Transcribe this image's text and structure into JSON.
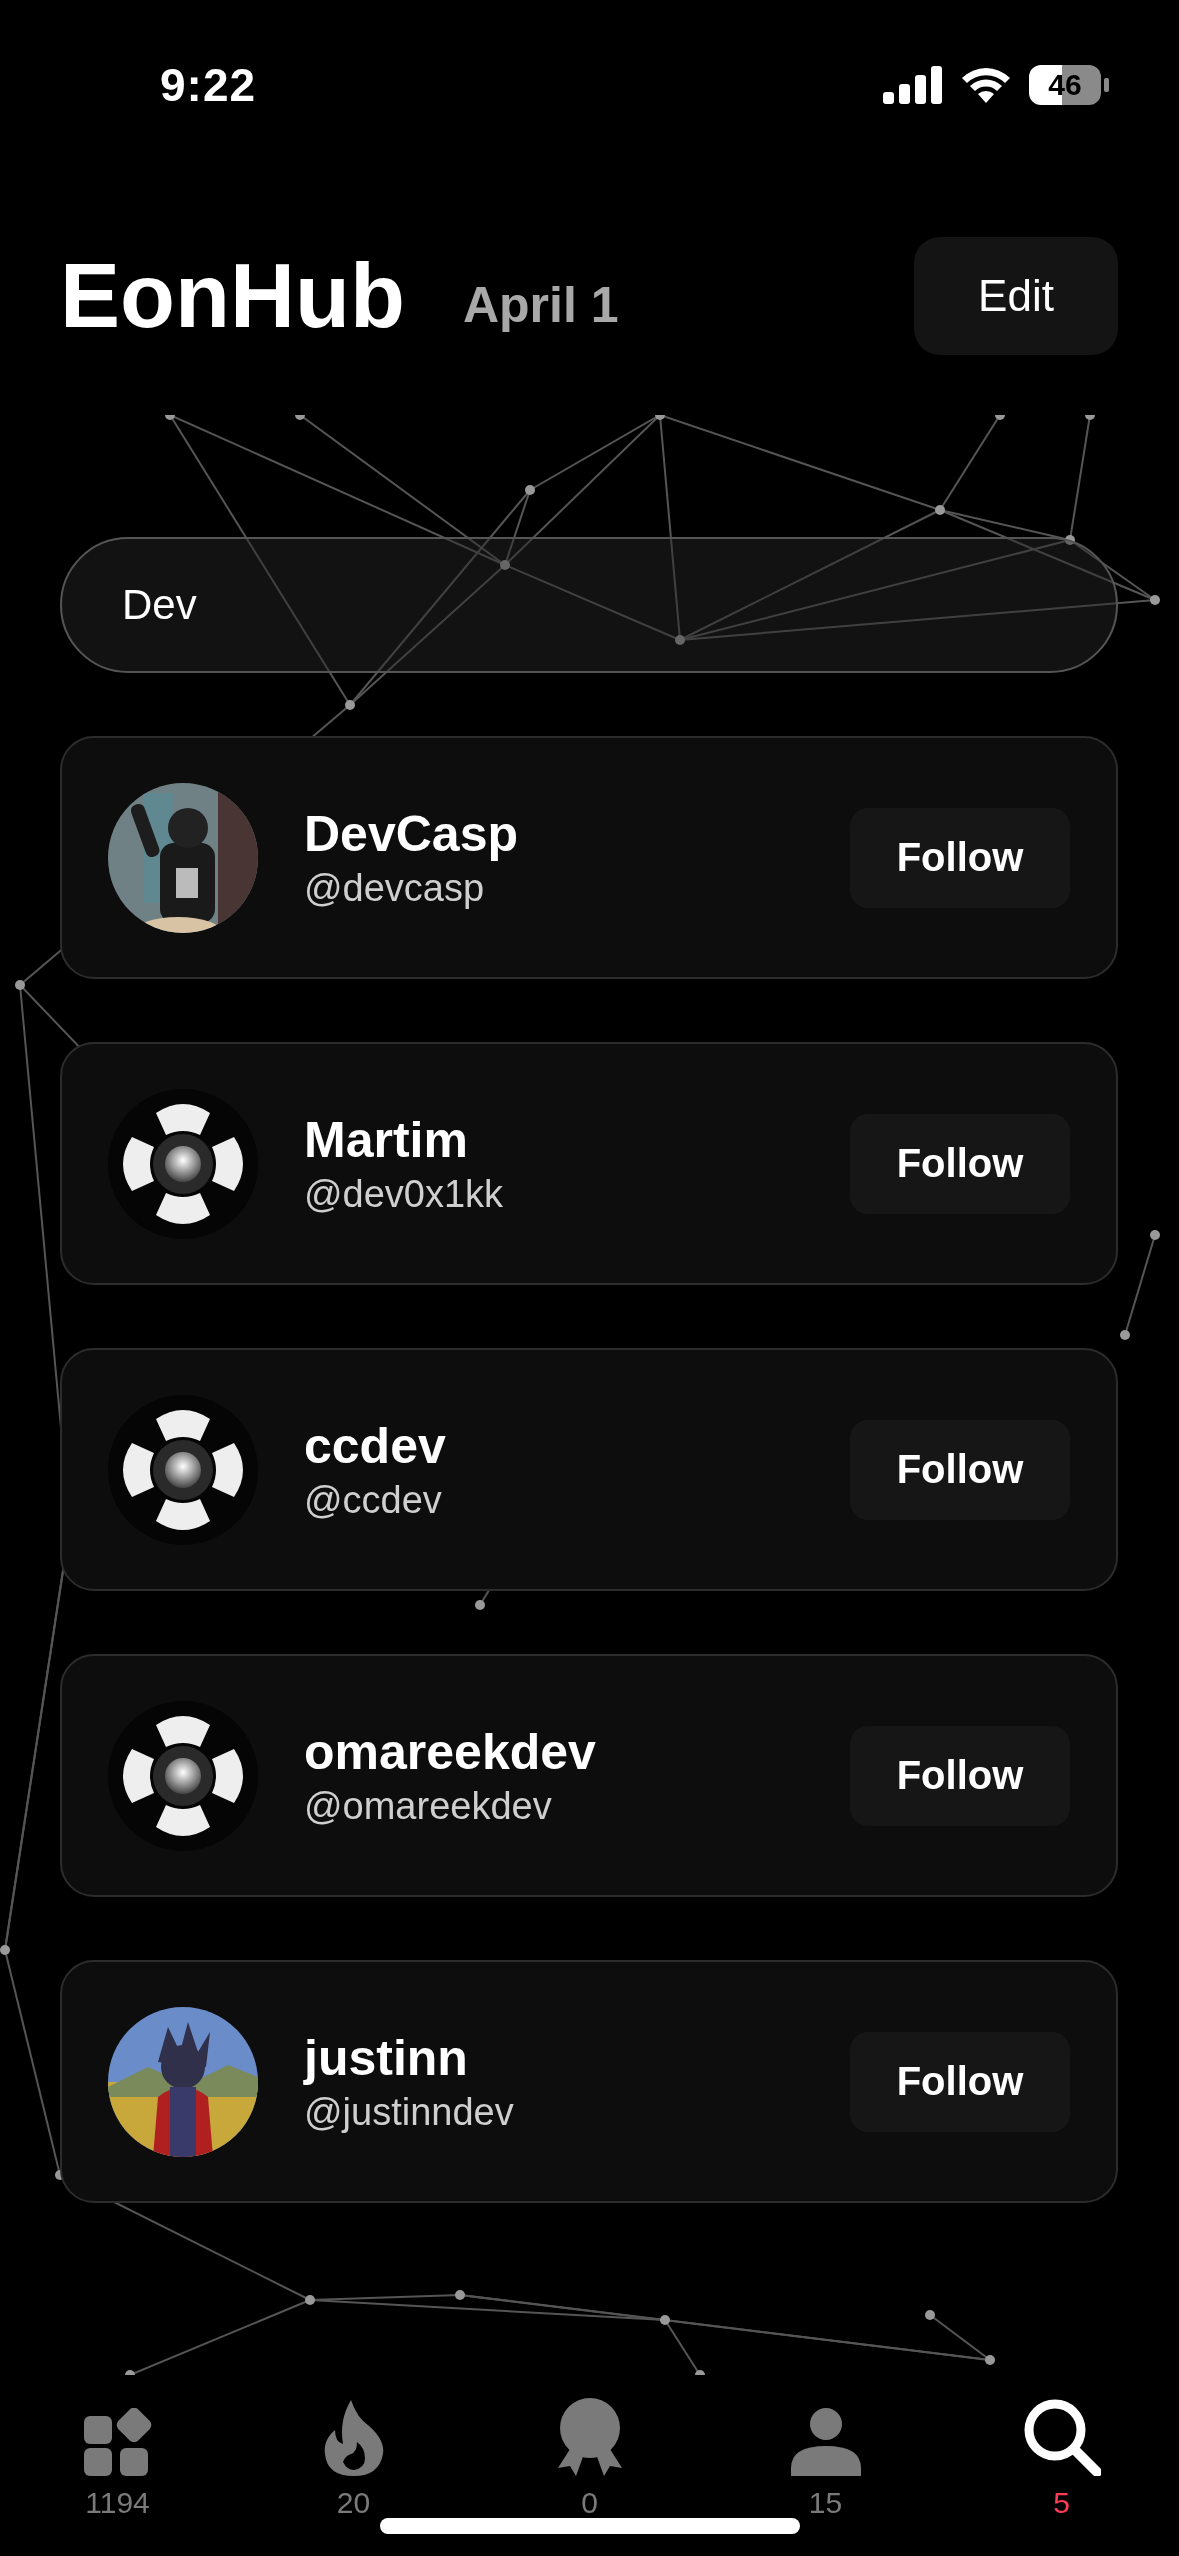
{
  "status_bar": {
    "time": "9:22",
    "battery": "46"
  },
  "header": {
    "title": "EonHub",
    "date": "April 1",
    "edit_button": "Edit"
  },
  "search": {
    "value": "Dev"
  },
  "results": [
    {
      "name": "DevCasp",
      "handle": "@devcasp",
      "kind": "picture",
      "button": "Follow"
    },
    {
      "name": "Martim",
      "handle": "@dev0x1kk",
      "kind": "logo",
      "button": "Follow"
    },
    {
      "name": "ccdev",
      "handle": "@ccdev",
      "kind": "logo",
      "button": "Follow"
    },
    {
      "name": "omareekdev",
      "handle": "@omareekdev",
      "kind": "logo",
      "button": "Follow"
    },
    {
      "name": "justinn",
      "handle": "@justinndev",
      "kind": "picture",
      "button": "Follow"
    }
  ],
  "tab_bar": [
    {
      "count": "1194",
      "selected": false
    },
    {
      "count": "20",
      "selected": false
    },
    {
      "count": "0",
      "selected": false
    },
    {
      "count": "15",
      "selected": false
    },
    {
      "count": "5",
      "selected": true
    }
  ]
}
